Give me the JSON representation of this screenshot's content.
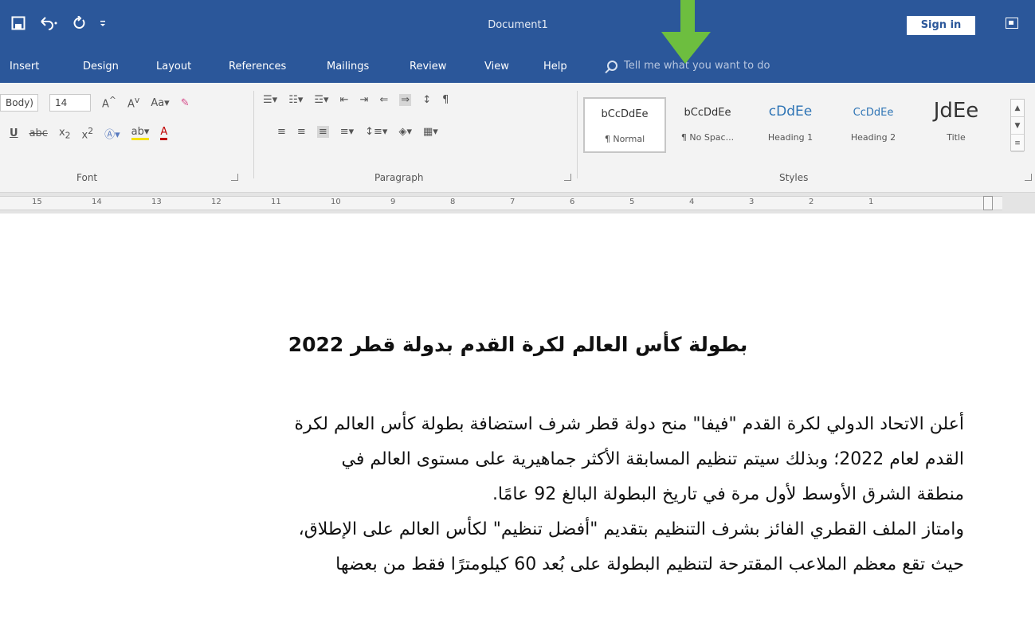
{
  "titlebar": {
    "document_title": "Document1",
    "sign_in": "Sign in",
    "qat_icons": [
      "save-icon",
      "undo-icon",
      "redo-icon",
      "customize-icon"
    ]
  },
  "tabs": [
    "Insert",
    "Design",
    "Layout",
    "References",
    "Mailings",
    "Review",
    "View",
    "Help"
  ],
  "tell_me": "Tell me what you want to do",
  "ribbon": {
    "font_name": "Body)",
    "font_size": "14",
    "groups": {
      "font": "Font",
      "paragraph": "Paragraph",
      "styles": "Styles"
    },
    "styles": [
      {
        "preview": "bCcDdEe",
        "name": "¶ Normal"
      },
      {
        "preview": "bCcDdEe",
        "name": "¶ No Spac..."
      },
      {
        "preview": "cDdEe",
        "name": "Heading 1"
      },
      {
        "preview": "CcDdEe",
        "name": "Heading 2"
      },
      {
        "preview": "JdEe",
        "name": "Title"
      }
    ]
  },
  "ruler_marks": [
    "15",
    "14",
    "13",
    "12",
    "11",
    "10",
    "9",
    "8",
    "7",
    "6",
    "5",
    "4",
    "3",
    "2",
    "1"
  ],
  "document": {
    "heading": "بطولة كأس العالم لكرة القدم بدولة قطر 2022",
    "lines": [
      "أعلن الاتحاد الدولي لكرة القدم \"فيفا\" منح دولة قطر شرف استضافة بطولة كأس العالم لكرة",
      "القدم لعام 2022؛ وبذلك سيتم تنظيم المسابقة الأكثر جماهيرية على مستوى العالم في",
      "منطقة الشرق الأوسط لأول مرة في تاريخ البطولة البالغ 92 عامًا.",
      "وامتاز الملف القطري الفائز بشرف التنظيم بتقديم \"أفضل تنظيم\" لكأس العالم على الإطلاق،",
      "حيث تقع معظم الملاعب المقترحة لتنظيم البطولة على بُعد 60 كيلومترًا فقط من بعضها"
    ]
  },
  "colors": {
    "ribbon_blue": "#2b579a",
    "arrow_green": "#6dbe3f"
  }
}
